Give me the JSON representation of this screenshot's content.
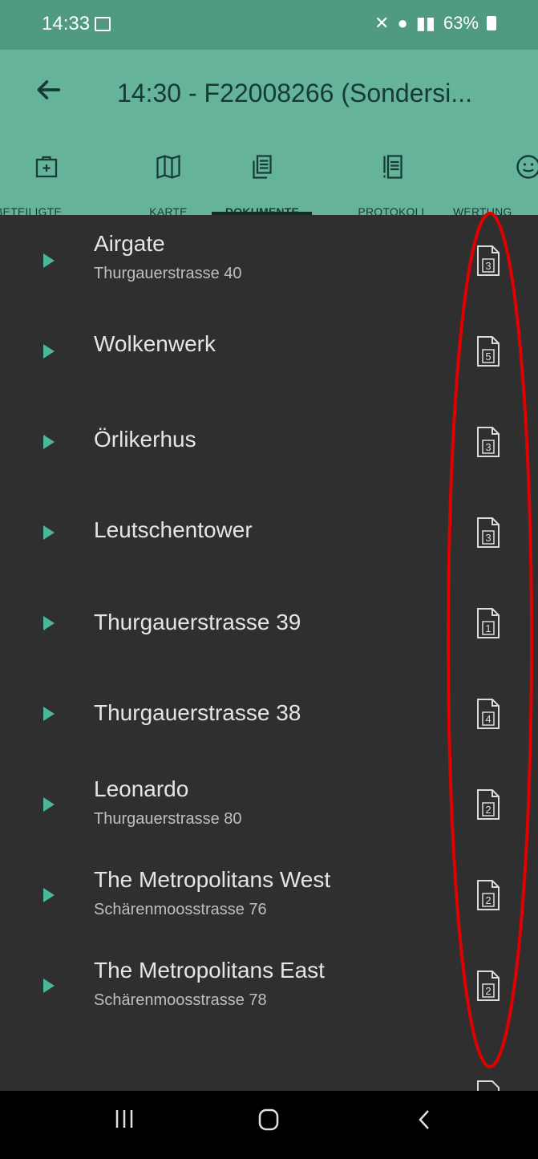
{
  "status_bar": {
    "time": "14:33",
    "battery": "63%"
  },
  "app_bar": {
    "title": "14:30 - F22008266 (Sondersi..."
  },
  "tabs": [
    {
      "label": "BETEILIGTE",
      "icon": "medical-kit-icon",
      "active": false
    },
    {
      "label": "KARTE",
      "icon": "map-icon",
      "active": false
    },
    {
      "label": "DOKUMENTE",
      "icon": "documents-icon",
      "active": true
    },
    {
      "label": "PROTOKOLL",
      "icon": "protocol-icon",
      "active": false
    },
    {
      "label": "WERTUNG",
      "icon": "smiley-icon",
      "active": false
    }
  ],
  "list": [
    {
      "title": "Airgate",
      "subtitle": "Thurgauerstrasse 40",
      "count": "3"
    },
    {
      "title": "Wolkenwerk",
      "subtitle": "",
      "count": "5"
    },
    {
      "title": "Örlikerhus",
      "subtitle": "",
      "count": "3"
    },
    {
      "title": "Leutschentower",
      "subtitle": "",
      "count": "3"
    },
    {
      "title": "Thurgauerstrasse 39",
      "subtitle": "",
      "count": "1"
    },
    {
      "title": "Thurgauerstrasse 38",
      "subtitle": "",
      "count": "4"
    },
    {
      "title": "Leonardo",
      "subtitle": "Thurgauerstrasse 80",
      "count": "2"
    },
    {
      "title": "The Metropolitans West",
      "subtitle": "Schärenmoosstrasse 76",
      "count": "2"
    },
    {
      "title": "The Metropolitans East",
      "subtitle": "Schärenmoosstrasse 78",
      "count": "2"
    }
  ],
  "colors": {
    "status_bar_bg": "#4f9a80",
    "app_bar_bg": "#64b39a",
    "list_bg": "#2f2f2f",
    "accent_chevron": "#4bb79a",
    "annotation": "#e00000"
  }
}
